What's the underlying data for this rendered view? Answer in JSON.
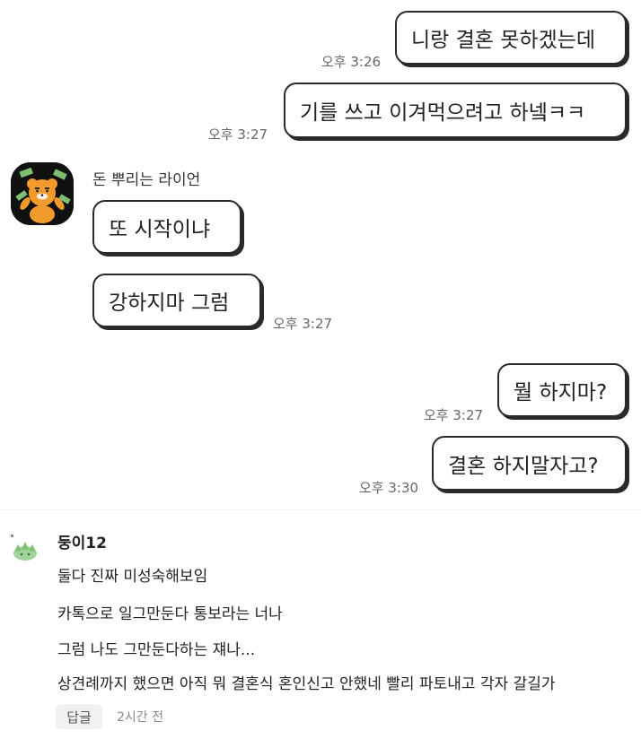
{
  "chat": {
    "messages": [
      {
        "side": "right",
        "text": "니랑 결혼 못하겠는데",
        "time": "오후 3:26"
      },
      {
        "side": "right",
        "text": "기를 쓰고 이겨먹으려고 하넼ㅋㅋ",
        "time": "오후 3:27"
      },
      {
        "side": "left",
        "text": "또 시작이냐",
        "time": ""
      },
      {
        "side": "left",
        "text": "강하지마 그럼",
        "time": "오후 3:27"
      },
      {
        "side": "right",
        "text": "뭘 하지마?",
        "time": "오후 3:27"
      },
      {
        "side": "right",
        "text": "결혼 하지말자고?",
        "time": "오후 3:30"
      }
    ],
    "sender_name": "돈 뿌리는 라이언"
  },
  "comment": {
    "author": "둥이12",
    "lines": [
      "둘다 진짜 미성숙해보임",
      "카톡으로 일그만둔다 통보라는 너나",
      "그럼 나도 그만둔다하는 쟤나...",
      "상견례까지 했으면 아직 뭐 결혼식 혼인신고 안했네 빨리 파토내고 각자 갈길가"
    ],
    "reply_label": "답글",
    "time_ago": "2시간 전"
  },
  "colors": {
    "bubble_border": "#2a2a2a",
    "avatar_bg": "#111111",
    "lion_orange": "#f39a2c",
    "money_green": "#7fbf72"
  },
  "icons": {
    "sender_avatar": "ryan-lion-money-icon",
    "commenter_avatar": "green-leaf-avatar-icon"
  }
}
